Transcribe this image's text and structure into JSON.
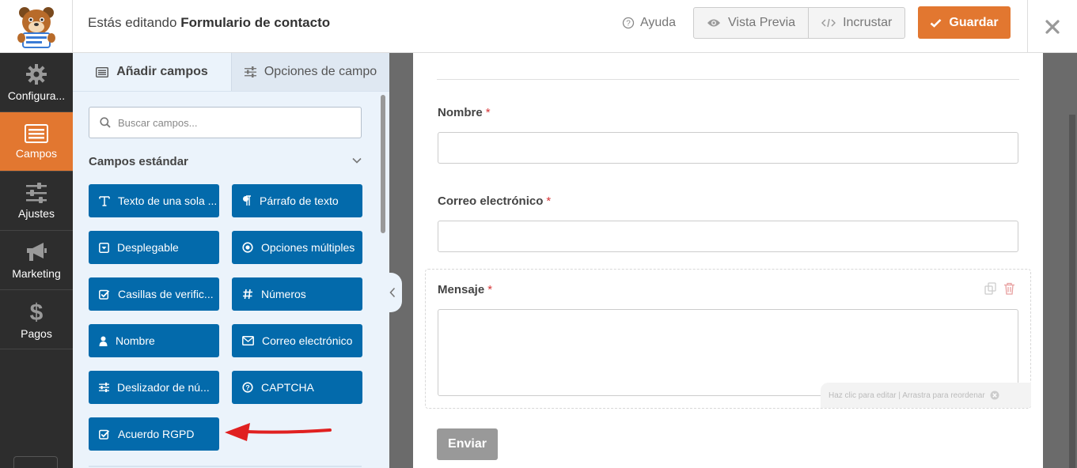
{
  "header": {
    "title_prefix": "Estás editando",
    "form_name": "Formulario de contacto",
    "help_label": "Ayuda",
    "preview_label": "Vista Previa",
    "embed_label": "Incrustar",
    "save_label": "Guardar",
    "save_color": "#e27730"
  },
  "sidebar": {
    "items": [
      {
        "label": "Configura...",
        "icon": "gear-icon"
      },
      {
        "label": "Campos",
        "icon": "form-list-icon",
        "active": true
      },
      {
        "label": "Ajustes",
        "icon": "sliders-icon"
      },
      {
        "label": "Marketing",
        "icon": "megaphone-icon"
      },
      {
        "label": "Pagos",
        "icon": "dollar-icon"
      }
    ]
  },
  "panel": {
    "tab_add": "Añadir campos",
    "tab_options": "Opciones de campo",
    "search_placeholder": "Buscar campos...",
    "section_title": "Campos estándar",
    "fields": [
      {
        "label": "Texto de una sola ...",
        "icon": "text-icon"
      },
      {
        "label": "Párrafo de texto",
        "icon": "paragraph-icon"
      },
      {
        "label": "Desplegable",
        "icon": "dropdown-icon"
      },
      {
        "label": "Opciones múltiples",
        "icon": "radio-icon"
      },
      {
        "label": "Casillas de verific...",
        "icon": "checkbox-icon"
      },
      {
        "label": "Números",
        "icon": "hash-icon"
      },
      {
        "label": "Nombre",
        "icon": "user-icon"
      },
      {
        "label": "Correo electrónico",
        "icon": "envelope-icon"
      },
      {
        "label": "Deslizador de nú...",
        "icon": "sliders-icon"
      },
      {
        "label": "CAPTCHA",
        "icon": "question-circle-icon"
      },
      {
        "label": "Acuerdo RGPD",
        "icon": "checkbox-icon"
      }
    ],
    "field_color": "#036aab"
  },
  "form": {
    "fields": [
      {
        "label": "Nombre",
        "required": "*"
      },
      {
        "label": "Correo electrónico",
        "required": "*"
      },
      {
        "label": "Mensaje",
        "required": "*"
      }
    ],
    "hint": "Haz clic para editar | Arrastra para reordenar",
    "submit_label": "Enviar"
  }
}
